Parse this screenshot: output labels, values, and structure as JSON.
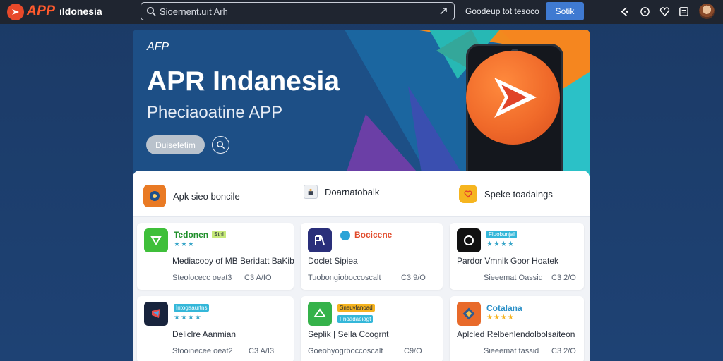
{
  "topbar": {
    "logo_text": "APP",
    "brand": "ıldonesia",
    "search_placeholder": "Sioernent.uıt Arh",
    "login_link": "Goodeup tot tesoco",
    "primary_button": "Sotik",
    "icons": [
      "share-icon",
      "info-icon",
      "heart-icon",
      "grid-icon"
    ]
  },
  "hero": {
    "tag": "AFP",
    "title": "APR Indanesia",
    "subtitle": "Pheciaoatine APP",
    "button_label": "Duisefetim"
  },
  "categories": [
    {
      "label": "Apk sieo boncile",
      "icon": "gear-icon",
      "color": "#e97a24"
    },
    {
      "label": "Doarnatobalk",
      "icon": "document-icon",
      "color": "#eef0f3"
    },
    {
      "label": "Speke toadaings",
      "icon": "heart-icon",
      "color": "#f6b51f"
    }
  ],
  "apps": [
    {
      "name": "Tedonen",
      "badge": "Stnl",
      "badge_color": "#8ed15a",
      "stars": "★★★",
      "star_color": "#3aa6c9",
      "desc": "Mediacooy of MB Beridatt BaKib",
      "meta1": "Steolocecc oeat3",
      "meta2": "C3 A/IO",
      "icon_color": "#3fbf3a"
    },
    {
      "name": "Bocicene",
      "badge": "",
      "badge_color": "",
      "stars": "",
      "star_color": "#3aa6c9",
      "desc": "Doclet Sipiea",
      "meta1": "Tuobongioboccoscalt",
      "meta2": "C3 9/O",
      "icon_color": "#2a2f7a"
    },
    {
      "name": "Fluobunjal",
      "badge": "",
      "badge_color": "#34b7d9",
      "stars": "★★★★",
      "star_color": "#3aa6c9",
      "desc": "Pardor Vmnik Goor Hoatek",
      "meta1": "Sieeemat Oassid",
      "meta2": "C3 2/O",
      "icon_color": "#111111"
    },
    {
      "name": "Intogaaurtns",
      "badge": "",
      "badge_color": "#34b7d9",
      "stars": "★★★★",
      "star_color": "#3aa6c9",
      "desc": "Deliclre Aanmian",
      "meta1": "Stooinecee oeat2",
      "meta2": "C3 A/I3",
      "icon_color": "#18243d"
    },
    {
      "name": "Fnoadaeiagt",
      "badge": "Sneuvlanoad",
      "badge_color": "#f5b31f",
      "stars": "",
      "star_color": "#3aa6c9",
      "desc": "Seplik | Sella Ccogrnt",
      "meta1": "Goeohyogrboccoscalt",
      "meta2": "C9/O",
      "icon_color": "#35b24a"
    },
    {
      "name": "Cotalana",
      "badge": "",
      "badge_color": "",
      "stars": "★★★★",
      "star_color": "#f5b31f",
      "desc": "Aplcled Relbenlendolbolsaiteon",
      "meta1": "Sieeemat tassid",
      "meta2": "C3 2/O",
      "icon_color": "#e86a2a"
    }
  ]
}
